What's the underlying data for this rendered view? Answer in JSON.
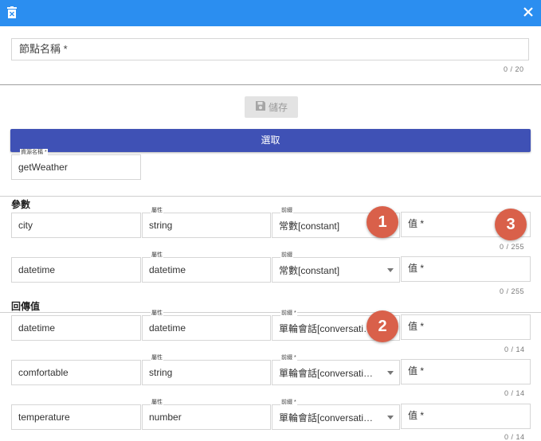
{
  "node_name": {
    "placeholder": "節點名稱 *",
    "counter": "0 / 20"
  },
  "toolbar": {
    "save_label": "儲存",
    "select_label": "選取"
  },
  "resource": {
    "label": "資源名稱 *",
    "value": "getWeather"
  },
  "params": {
    "title": "參數",
    "rows": [
      {
        "name": "city",
        "attr_label": "屬性",
        "attr": "string",
        "prefix_label": "前綴",
        "prefix": "常數[constant]",
        "value_placeholder": "值 *",
        "counter": "0 / 255"
      },
      {
        "name": "datetime",
        "attr_label": "屬性",
        "attr": "datetime",
        "prefix_label": "前綴",
        "prefix": "常數[constant]",
        "value_placeholder": "值 *",
        "counter": "0 / 255"
      }
    ]
  },
  "returns": {
    "title": "回傳值",
    "rows": [
      {
        "name": "datetime",
        "attr_label": "屬性",
        "attr": "datetime",
        "prefix_label": "前綴 *",
        "prefix": "單輪會話[conversati…",
        "value_placeholder": "值 *",
        "counter": "0 / 14"
      },
      {
        "name": "comfortable",
        "attr_label": "屬性",
        "attr": "string",
        "prefix_label": "前綴 *",
        "prefix": "單輪會話[conversati…",
        "value_placeholder": "值 *",
        "counter": "0 / 14"
      },
      {
        "name": "temperature",
        "attr_label": "屬性",
        "attr": "number",
        "prefix_label": "前綴 *",
        "prefix": "單輪會話[conversati…",
        "value_placeholder": "值 *",
        "counter": "0 / 14"
      }
    ]
  },
  "badges": [
    "1",
    "2",
    "3"
  ],
  "colors": {
    "topbar": "#2b8ef0",
    "select_button": "#3f51b5",
    "badge": "#d9604a",
    "save_disabled": "#e3e3e3"
  }
}
